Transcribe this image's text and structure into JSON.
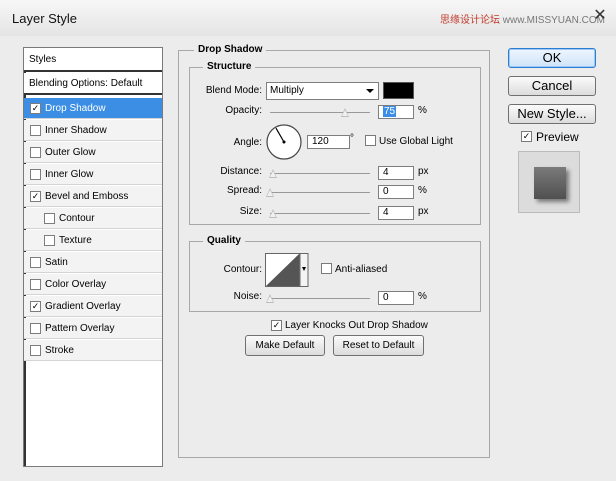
{
  "window": {
    "title": "Layer Style",
    "watermark_cn": "思缘设计论坛",
    "watermark_url": "www.MISSYUAN.COM"
  },
  "style_list": {
    "header": "Styles",
    "blending": "Blending Options: Default",
    "items": [
      {
        "label": "Drop Shadow",
        "checked": "✓",
        "selected": true
      },
      {
        "label": "Inner Shadow",
        "checked": ""
      },
      {
        "label": "Outer Glow",
        "checked": ""
      },
      {
        "label": "Inner Glow",
        "checked": ""
      },
      {
        "label": "Bevel and Emboss",
        "checked": "✓"
      },
      {
        "label": "Contour",
        "checked": "",
        "indent": true
      },
      {
        "label": "Texture",
        "checked": "",
        "indent": true
      },
      {
        "label": "Satin",
        "checked": ""
      },
      {
        "label": "Color Overlay",
        "checked": ""
      },
      {
        "label": "Gradient Overlay",
        "checked": "✓"
      },
      {
        "label": "Pattern Overlay",
        "checked": ""
      },
      {
        "label": "Stroke",
        "checked": ""
      }
    ]
  },
  "drop_shadow": {
    "section_title": "Drop Shadow",
    "structure": {
      "title": "Structure",
      "blend_mode_label": "Blend Mode:",
      "blend_mode_value": "Multiply",
      "shadow_color": "#000000",
      "opacity_label": "Opacity:",
      "opacity_value": "75",
      "opacity_unit": "%",
      "opacity_level": 0.75,
      "angle_label": "Angle:",
      "angle_value": "120",
      "angle_unit": "°",
      "use_global_light_label": "Use Global Light",
      "use_global_light_checked": "",
      "distance_label": "Distance:",
      "distance_value": "4",
      "distance_unit": "px",
      "spread_label": "Spread:",
      "spread_value": "0",
      "spread_unit": "%",
      "size_label": "Size:",
      "size_value": "4",
      "size_unit": "px"
    },
    "quality": {
      "title": "Quality",
      "contour_label": "Contour:",
      "anti_aliased_label": "Anti-aliased",
      "anti_aliased_checked": "",
      "noise_label": "Noise:",
      "noise_value": "0",
      "noise_unit": "%"
    },
    "layer_knocks_out_label": "Layer Knocks Out Drop Shadow",
    "layer_knocks_out_checked": "✓",
    "make_default_label": "Make Default",
    "reset_default_label": "Reset to Default"
  },
  "buttons": {
    "ok": "OK",
    "cancel": "Cancel",
    "new_style": "New Style...",
    "preview_label": "Preview",
    "preview_checked": "✓"
  }
}
